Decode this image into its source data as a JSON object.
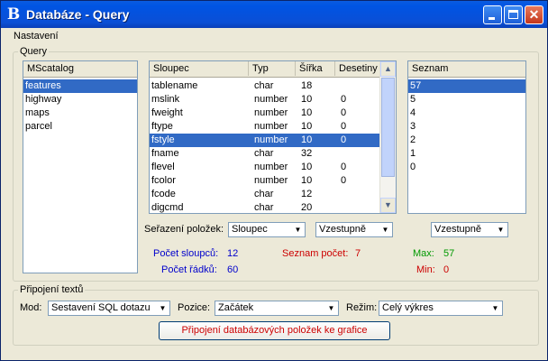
{
  "window": {
    "title": "Databáze - Query",
    "icon": "B"
  },
  "menu": {
    "settings_label": "Nastavení"
  },
  "query_group": {
    "label": "Query",
    "catalog": {
      "header": "MScatalog",
      "items": [
        "features",
        "highway",
        "maps",
        "parcel"
      ],
      "selected_index": 0
    },
    "columns_table": {
      "headers": [
        "Sloupec",
        "Typ",
        "Šířka",
        "Desetiny"
      ],
      "rows": [
        [
          "tablename",
          "char",
          "18",
          ""
        ],
        [
          "mslink",
          "number",
          "10",
          "0"
        ],
        [
          "fweight",
          "number",
          "10",
          "0"
        ],
        [
          "ftype",
          "number",
          "10",
          "0"
        ],
        [
          "fstyle",
          "number",
          "10",
          "0"
        ],
        [
          "fname",
          "char",
          "32",
          ""
        ],
        [
          "flevel",
          "number",
          "10",
          "0"
        ],
        [
          "fcolor",
          "number",
          "10",
          "0"
        ],
        [
          "fcode",
          "char",
          "12",
          ""
        ],
        [
          "digcmd",
          "char",
          "20",
          ""
        ]
      ],
      "selected_index": 4
    },
    "list": {
      "header": "Seznam",
      "items": [
        "57",
        "5",
        "4",
        "3",
        "2",
        "1",
        "0"
      ],
      "selected_index": 0
    },
    "sort_label": "Seřazení položek:",
    "sort_column_value": "Sloupec",
    "sort_order_value": "Vzestupně",
    "list_order_value": "Vzestupně",
    "stats": {
      "columns_count_label": "Počet sloupců:",
      "columns_count": "12",
      "rows_count_label": "Počet řádků:",
      "rows_count": "60",
      "list_count_label": "Seznam počet:",
      "list_count": "7",
      "max_label": "Max:",
      "max_value": "57",
      "min_label": "Min:",
      "min_value": "0"
    }
  },
  "attach_group": {
    "label": "Připojení textů",
    "mode_label": "Mod:",
    "mode_value": "Sestavení SQL dotazu",
    "position_label": "Pozice:",
    "position_value": "Začátek",
    "regime_label": "Režim:",
    "regime_value": "Celý výkres",
    "attach_button_label": "Připojení databázových položek ke grafice"
  }
}
